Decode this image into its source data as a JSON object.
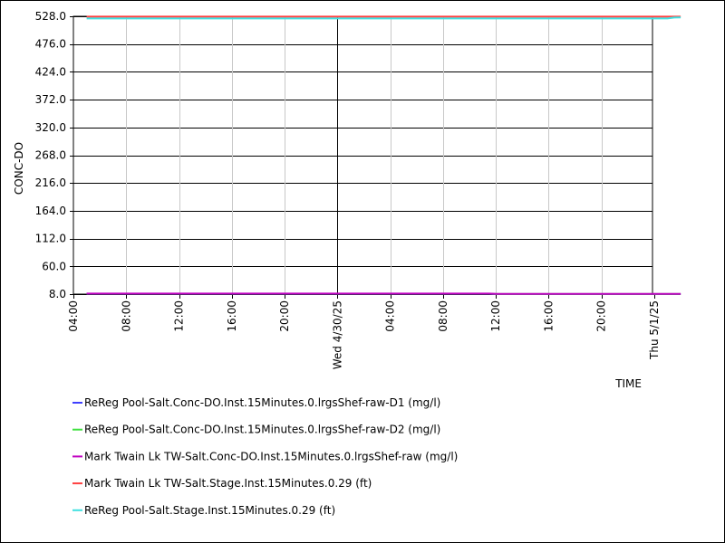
{
  "chart_data": {
    "type": "line",
    "title": "",
    "xlabel": "TIME",
    "ylabel": "CONC-DO",
    "ylim": [
      8.0,
      528.0
    ],
    "y_ticks": [
      "528.0",
      "476.0",
      "424.0",
      "372.0",
      "320.0",
      "268.0",
      "216.0",
      "164.0",
      "112.0",
      "60.0",
      "8.0"
    ],
    "x_range_hours": [
      0,
      64
    ],
    "x_ticks": [
      {
        "label": "04:00",
        "h": 0
      },
      {
        "label": "08:00",
        "h": 4
      },
      {
        "label": "12:00",
        "h": 8
      },
      {
        "label": "16:00",
        "h": 12
      },
      {
        "label": "20:00",
        "h": 16
      },
      {
        "label": "Wed 4/30/25",
        "h": 20
      },
      {
        "label": "04:00",
        "h": 24
      },
      {
        "label": "08:00",
        "h": 28
      },
      {
        "label": "12:00",
        "h": 32
      },
      {
        "label": "16:00",
        "h": 36
      },
      {
        "label": "20:00",
        "h": 40
      },
      {
        "label": "Thu 5/1/25",
        "h": 44
      }
    ],
    "grid": true,
    "legend_position": "bottom",
    "series": [
      {
        "name": "ReReg Pool-Salt.Conc-DO.Inst.15Minutes.0.lrgsShef-raw-D1 (mg/l)",
        "color": "#4040ff",
        "x": [
          1,
          31.5,
          32,
          46
        ],
        "y": [
          8.6,
          8.6,
          8.0,
          8.0
        ]
      },
      {
        "name": "ReReg Pool-Salt.Conc-DO.Inst.15Minutes.0.lrgsShef-raw-D2 (mg/l)",
        "color": "#40e040",
        "x": [
          1,
          31.5,
          32,
          46
        ],
        "y": [
          8.8,
          8.8,
          8.2,
          8.2
        ]
      },
      {
        "name": "Mark Twain Lk TW-Salt.Conc-DO.Inst.15Minutes.0.lrgsShef-raw (mg/l)",
        "color": "#c000c0",
        "x": [
          1,
          31.5,
          32,
          46
        ],
        "y": [
          9.0,
          9.0,
          8.4,
          8.4
        ]
      },
      {
        "name": "Mark Twain Lk TW-Salt.Stage.Inst.15Minutes.0.29 (ft)",
        "color": "#ff4040",
        "x": [
          1,
          46
        ],
        "y": [
          527.3,
          527.3
        ]
      },
      {
        "name": "ReReg Pool-Salt.Stage.Inst.15Minutes.0.29 (ft)",
        "color": "#40e0e0",
        "x": [
          1,
          45,
          45.5,
          46
        ],
        "y": [
          524.0,
          524.0,
          525.6,
          525.8
        ]
      }
    ]
  },
  "colors": {
    "grid_major": "#000000",
    "grid_minor": "#c8c8c8",
    "background": "#ffffff"
  }
}
